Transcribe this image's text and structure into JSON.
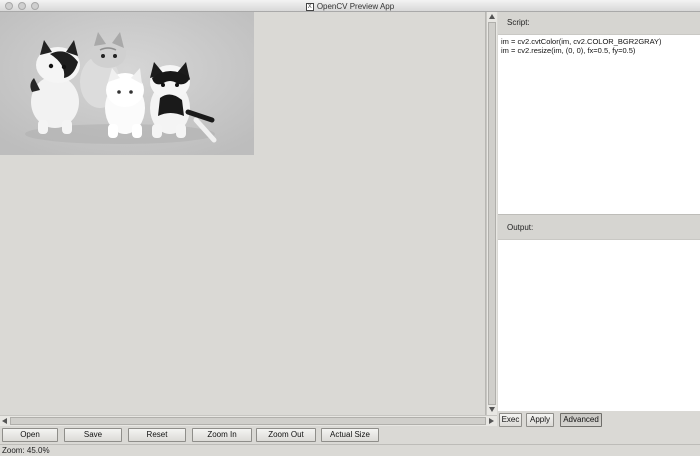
{
  "window": {
    "title": "OpenCV Preview App"
  },
  "script": {
    "label": "Script:",
    "lines": [
      "im = cv2.cvtColor(im, cv2.COLOR_BGR2GRAY)",
      "im = cv2.resize(im, (0, 0), fx=0.5, fy=0.5)"
    ]
  },
  "output": {
    "label": "Output:",
    "text": ""
  },
  "toolbar": {
    "open_label": "Open",
    "save_label": "Save",
    "reset_label": "Reset",
    "zoom_in_label": "Zoom In",
    "zoom_out_label": "Zoom Out",
    "actual_size_label": "Actual Size"
  },
  "script_buttons": {
    "exec_label": "Exec",
    "apply_label": "Apply",
    "advanced_label": "Advanced"
  },
  "status": {
    "text": "Zoom: 45.0%"
  },
  "icons": [
    "app-icon",
    "up-arrow-icon",
    "down-arrow-icon",
    "left-arrow-icon",
    "right-arrow-icon"
  ]
}
